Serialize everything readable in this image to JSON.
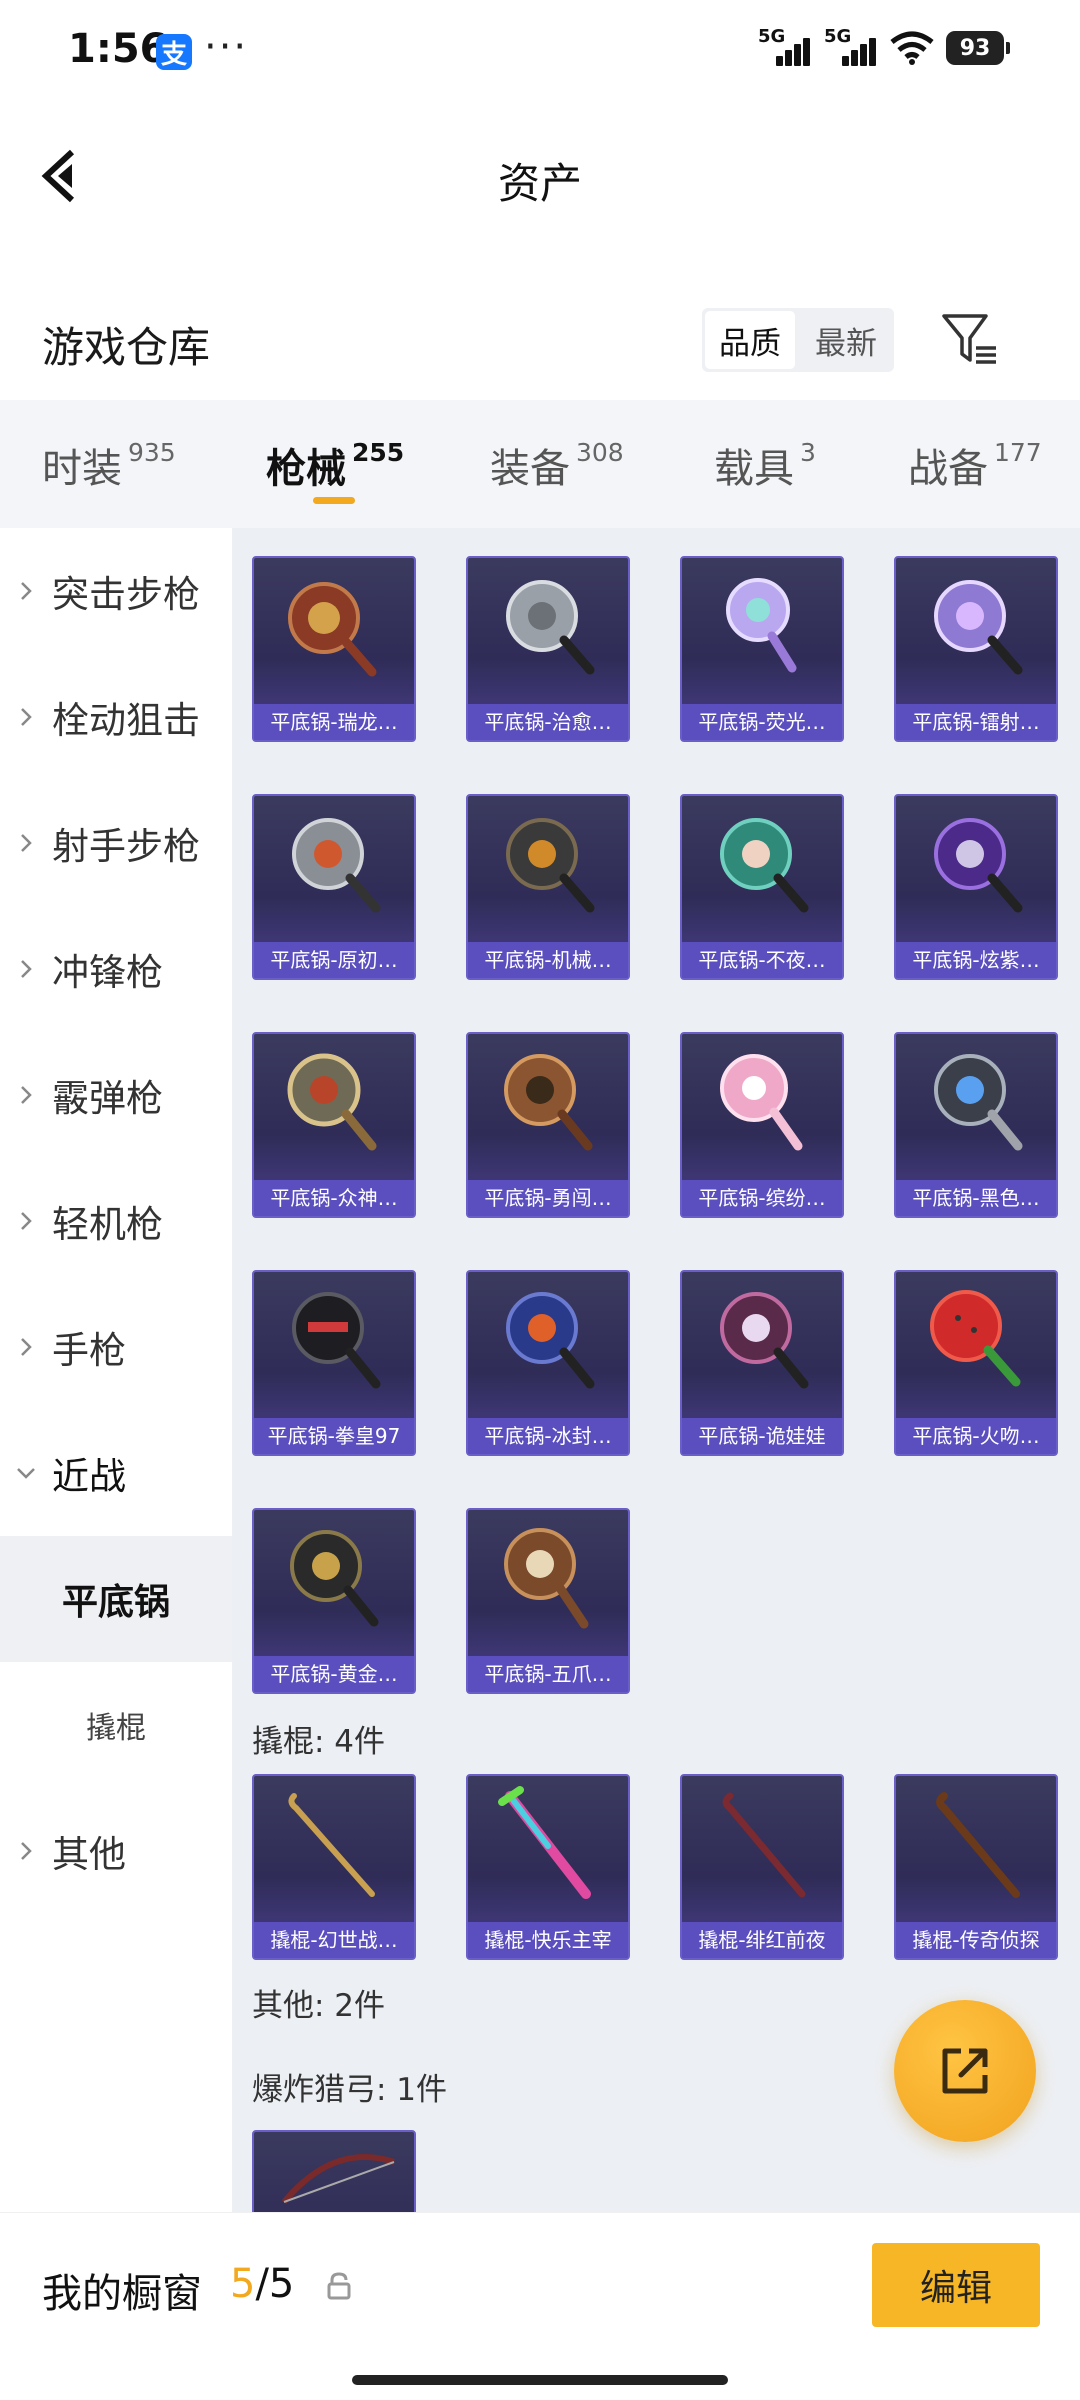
{
  "status_bar": {
    "time": "1:56",
    "alipay_badge": "支",
    "dots": "···",
    "signal1": "5G",
    "signal2": "5G",
    "battery": "93"
  },
  "header": {
    "title": "资产"
  },
  "warehouse": {
    "title": "游戏仓库",
    "sort_options": [
      "品质",
      "最新"
    ],
    "active_sort": "品质"
  },
  "tabs": [
    {
      "label": "时装",
      "count": "935"
    },
    {
      "label": "枪械",
      "count": "255",
      "active": true
    },
    {
      "label": "装备",
      "count": "308"
    },
    {
      "label": "载具",
      "count": "3"
    },
    {
      "label": "战备",
      "count": "177"
    }
  ],
  "sidebar": {
    "items": [
      "突击步枪",
      "栓动狙击",
      "射手步枪",
      "冲锋枪",
      "霰弹枪",
      "轻机枪",
      "手枪",
      "近战"
    ],
    "sub_items": [
      "平底锅",
      "撬棍"
    ],
    "selected_sub": "平底锅",
    "last_item": "其他"
  },
  "pans": [
    "平底锅-瑞龙…",
    "平底锅-治愈…",
    "平底锅-荧光…",
    "平底锅-镭射…",
    "平底锅-原初…",
    "平底锅-机械…",
    "平底锅-不夜…",
    "平底锅-炫紫…",
    "平底锅-众神…",
    "平底锅-勇闯…",
    "平底锅-缤纷…",
    "平底锅-黑色…",
    "平底锅-拳皇97",
    "平底锅-冰封…",
    "平底锅-诡娃娃",
    "平底锅-火吻…",
    "平底锅-黄金…",
    "平底锅-五爪…"
  ],
  "crowbar_section": {
    "label": "撬棍: 4件"
  },
  "crowbars": [
    "撬棍-幻世战…",
    "撬棍-快乐主宰",
    "撬棍-绯红前夜",
    "撬棍-传奇侦探"
  ],
  "other_section": {
    "label": "其他: 2件"
  },
  "bow_section": {
    "label": "爆炸猎弓: 1件"
  },
  "bottom_bar": {
    "title": "我的橱窗",
    "current": "5",
    "total": "/5",
    "edit_label": "编辑"
  },
  "colors": {
    "accent": "#f2a81f",
    "card_caption": "#5b4fbf",
    "card_bg": "#2f2c57",
    "edit_button": "#f6b625"
  }
}
